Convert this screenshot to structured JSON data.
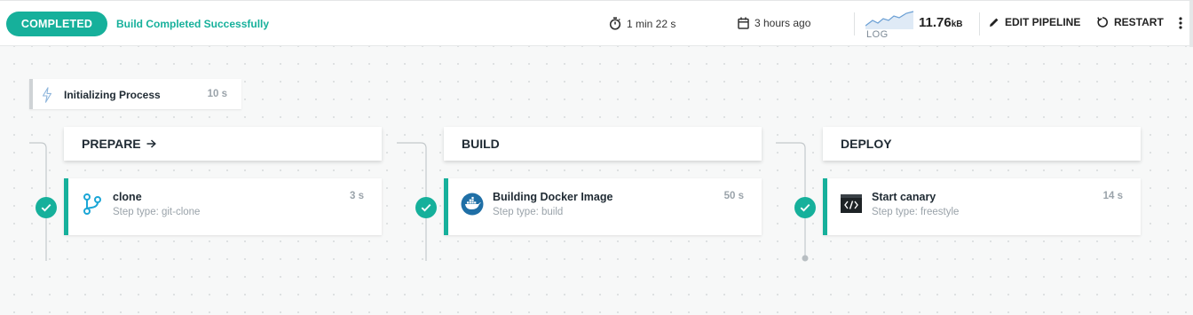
{
  "header": {
    "status": "COMPLETED",
    "status_message": "Build Completed Successfully",
    "duration": "1 min 22 s",
    "started": "3 hours ago",
    "log": {
      "label": "LOG",
      "size": "11.76",
      "unit": "kB"
    },
    "edit_label": "EDIT PIPELINE",
    "restart_label": "RESTART"
  },
  "init_step": {
    "label": "Initializing Process",
    "duration": "10 s"
  },
  "stages": [
    {
      "name": "PREPARE",
      "step": {
        "name": "clone",
        "type": "Step type: git-clone",
        "duration": "3 s",
        "icon": "git-branch-icon"
      }
    },
    {
      "name": "BUILD",
      "step": {
        "name": "Building Docker Image",
        "type": "Step type: build",
        "duration": "50 s",
        "icon": "docker-icon"
      }
    },
    {
      "name": "DEPLOY",
      "step": {
        "name": "Start canary",
        "type": "Step type: freestyle",
        "duration": "14 s",
        "icon": "code-terminal-icon"
      }
    }
  ],
  "colors": {
    "accent": "#16b09b",
    "docker": "#1f6fa6",
    "muted": "#9aa3aa"
  }
}
